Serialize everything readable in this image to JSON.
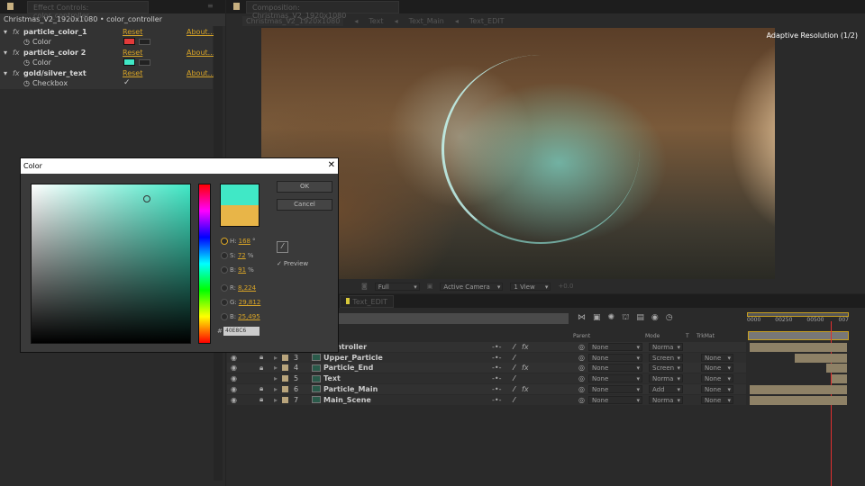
{
  "effect_controls": {
    "tab_title": "Effect Controls: color_controller",
    "breadcrumb": "Christmas_V2_1920x1080 • color_controller",
    "effects": [
      {
        "name": "particle_color_1",
        "reset": "Reset",
        "about": "About...",
        "param": "Color",
        "color": "#e23a3a"
      },
      {
        "name": "particle_color 2",
        "reset": "Reset",
        "about": "About...",
        "param": "Color",
        "color": "#40e8c6"
      },
      {
        "name": "gold/silver_text",
        "reset": "Reset",
        "about": "About...",
        "param": "Checkbox",
        "checked": "✓"
      }
    ]
  },
  "composition": {
    "tab_title": "Composition: Christmas_V2_1920x1080",
    "breadcrumbs": [
      "Christmas_V2_1920x1080",
      "Text",
      "Text_Main",
      "Text_EDIT"
    ],
    "overlay": "Adaptive Resolution (1/2)",
    "toolbar": {
      "resolution": "Full",
      "camera": "Active Camera",
      "views": "1 View",
      "exposure": "+0.0"
    }
  },
  "color_dialog": {
    "title": "Color",
    "ok": "OK",
    "cancel": "Cancel",
    "new_color": "#40e8c6",
    "old_color": "#e8b548",
    "fields": [
      {
        "label": "H:",
        "value": "168",
        "unit": "°",
        "selected": true
      },
      {
        "label": "S:",
        "value": "72",
        "unit": "%"
      },
      {
        "label": "B:",
        "value": "91",
        "unit": "%"
      },
      {
        "label": "R:",
        "value": "8,224",
        "unit": ""
      },
      {
        "label": "G:",
        "value": "29,812",
        "unit": ""
      },
      {
        "label": "B:",
        "value": "25,495",
        "unit": ""
      }
    ],
    "preview_label": "Preview",
    "preview_checked": true,
    "hex_label": "#",
    "hex": "40E8C6"
  },
  "timeline": {
    "tab": "Text_EDIT",
    "columns": {
      "parent": "Parent",
      "mode": "Mode",
      "t": "T",
      "trkmat": "TrkMat"
    },
    "ruler": [
      "0000",
      "00250",
      "00500",
      "007"
    ],
    "layers": [
      {
        "num": "",
        "name": "_controller",
        "parent": "None",
        "mode": "Norma",
        "trkmat": "",
        "fx": "fx",
        "bar": [
          0,
          100
        ]
      },
      {
        "num": "3",
        "name": "Upper_Particle",
        "parent": "None",
        "mode": "Screen",
        "trkmat": "None",
        "fx": "",
        "bar": [
          46,
          100
        ]
      },
      {
        "num": "4",
        "name": "Particle_End",
        "parent": "None",
        "mode": "Screen",
        "trkmat": "None",
        "fx": "fx",
        "bar": [
          79,
          100
        ]
      },
      {
        "num": "5",
        "name": "Text",
        "parent": "None",
        "mode": "Norma",
        "trkmat": "None",
        "fx": "",
        "bar": [
          84,
          100
        ]
      },
      {
        "num": "6",
        "name": "Particle_Main",
        "parent": "None",
        "mode": "Add",
        "trkmat": "None",
        "fx": "fx",
        "bar": [
          0,
          100
        ]
      },
      {
        "num": "7",
        "name": "Main_Scene",
        "parent": "None",
        "mode": "Norma",
        "trkmat": "None",
        "fx": "",
        "bar": [
          0,
          100
        ]
      }
    ]
  }
}
